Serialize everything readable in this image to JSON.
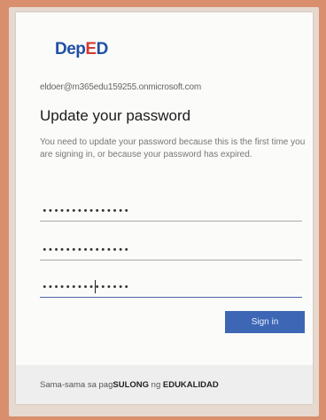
{
  "brand": {
    "logo_text_dep": "Dep",
    "logo_text_e": "E",
    "logo_text_d": "D"
  },
  "account": {
    "email": "eldoer@m365edu159255.onmicrosoft.com"
  },
  "page": {
    "title": "Update your password",
    "description": "You need to update your password because this is the first time you are signing in, or because your password has expired."
  },
  "fields": {
    "current_password": {
      "value": "•••••••••••••••"
    },
    "new_password": {
      "value": "•••••••••••••••"
    },
    "confirm_password": {
      "value": "•••••••••••••••"
    }
  },
  "actions": {
    "signin_label": "Sign in"
  },
  "footer": {
    "text_prefix": "Sama-sama sa pag",
    "text_bold1": "SULONG",
    "text_mid": " ng ",
    "text_bold2": "EDUKALIDAD"
  },
  "colors": {
    "background": "#d98f6e",
    "accent": "#3d67b5",
    "logo_blue": "#1f4fa6",
    "logo_red": "#d63a32"
  }
}
